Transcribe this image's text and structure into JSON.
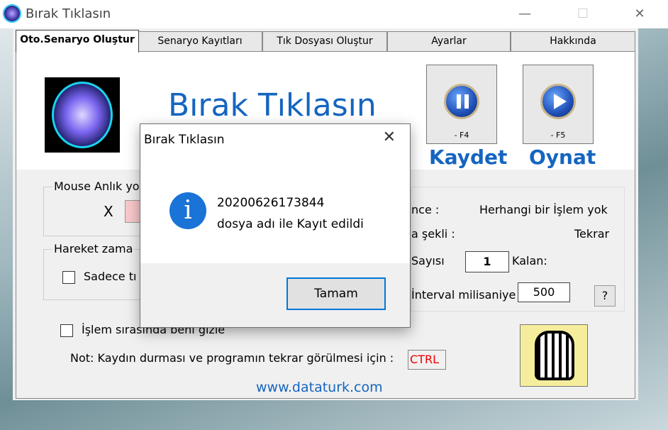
{
  "window": {
    "title": "Bırak Tıklasın",
    "minimize": "—",
    "maximize": "☐",
    "close": "✕"
  },
  "tabs": [
    {
      "label": "Oto.Senaryo Oluştur",
      "active": true
    },
    {
      "label": "Senaryo Kayıtları"
    },
    {
      "label": "Tık Dosyası Oluştur"
    },
    {
      "label": "Ayarlar"
    },
    {
      "label": "Hakkında"
    }
  ],
  "header": {
    "app_title": "Bırak Tıklasın"
  },
  "toolbar": {
    "record": {
      "hotkey": "- F4",
      "label": "Kaydet",
      "icon": "pause-icon"
    },
    "play": {
      "hotkey": "- F5",
      "label": "Oynat",
      "icon": "play-icon"
    }
  },
  "mouse_group": {
    "title": "Mouse Anlık yo",
    "x_label": "X"
  },
  "move_group": {
    "title": "Hareket zama",
    "only_checkbox": "Sadece tı",
    "only_checked": false
  },
  "status": {
    "state_label": "nce :",
    "state_value": "Herhangi bir İşlem yok",
    "mode_label": "a şekli :",
    "mode_value": "Tekrar",
    "count_label": "Sayısı",
    "count_value": "1",
    "remaining_label": "Kalan:",
    "interval_label": "İnterval milisaniye",
    "interval_value": "500",
    "help": "?"
  },
  "hide_checkbox": {
    "label": "İşlem sırasında beni gizle",
    "checked": false
  },
  "note": {
    "text": "Not: Kaydın durması ve programın tekrar görülmesi için :",
    "key": "CTRL"
  },
  "site": "www.dataturk.com",
  "dialog": {
    "title": "Bırak Tıklasın",
    "close": "✕",
    "icon": "info-icon",
    "message_line1": "20200626173844",
    "message_line2": "dosya adı ile Kayıt edildi",
    "ok_button": "Tamam"
  },
  "colors": {
    "accent": "#1565c0",
    "ok_border": "#0078d7",
    "ctrl_text": "#e00000"
  }
}
